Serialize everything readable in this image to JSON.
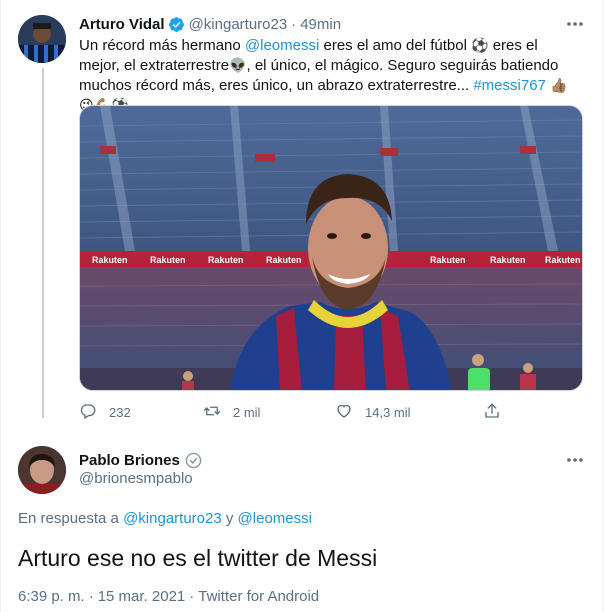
{
  "parent_tweet": {
    "author_name": "Arturo Vidal",
    "handle": "@kingarturo23",
    "separator": "·",
    "time": "49min",
    "text_parts": {
      "p1": "Un récord más hermano ",
      "mention": "@leomessi",
      "p2": " eres el amo del fútbol ",
      "p3": " eres el mejor, el extraterrestre",
      "p4": ", el único, el mágico. Seguro seguirás batiendo muchos récord más, eres único, un abrazo extraterrestre... ",
      "hashtag": "#messi767"
    },
    "emojis": {
      "soccer_ball": "⚽",
      "alien": "👽",
      "thumbs_up": "👍🏽",
      "wink": "😉",
      "flexed": "💪🏽"
    },
    "media": {
      "description_icon": "photo-icon",
      "banner_text": "Rakuten"
    },
    "actions": {
      "replies": "232",
      "retweets": "2 mil",
      "likes": "14,3 mil"
    }
  },
  "main_tweet": {
    "author_name": "Pablo Briones",
    "handle": "@brionesmpablo",
    "reply_prefix": "En respuesta a ",
    "reply_user1": "@kingarturo23",
    "reply_and": " y ",
    "reply_user2": "@leomessi",
    "text": "Arturo ese no es el twitter de Messi",
    "time": "6:39 p. m.",
    "date": "15 mar. 2021",
    "separator": "·",
    "source": "Twitter for Android"
  },
  "colors": {
    "link": "#1b95e0",
    "secondary": "#5b7083",
    "verified": "#1da1f2"
  }
}
